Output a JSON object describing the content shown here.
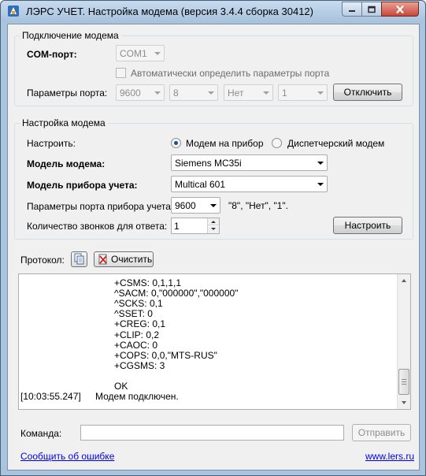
{
  "window": {
    "title": "ЛЭРС УЧЕТ. Настройка модема (версия 3.4.4 сборка 30412)"
  },
  "connection": {
    "group_title": "Подключение модема",
    "com_port_label": "COM-порт:",
    "com_port_value": "COM1",
    "auto_detect_label": "Автоматически определить параметры порта",
    "auto_detect_checked": false,
    "port_params_label": "Параметры порта:",
    "baud": "9600",
    "data_bits": "8",
    "parity": "Нет",
    "stop_bits": "1",
    "disconnect_button": "Отключить"
  },
  "modem_setup": {
    "group_title": "Настройка модема",
    "configure_label": "Настроить:",
    "radio_device": "Модем на прибор",
    "radio_dispatcher": "Диспетчерский модем",
    "selected_mode": "device",
    "modem_model_label": "Модель модема:",
    "modem_model_value": "Siemens MC35i",
    "meter_model_label": "Модель прибора учета:",
    "meter_model_value": "Multical 601",
    "meter_port_label": "Параметры порта прибора учета:",
    "meter_port_value": "9600",
    "meter_port_hint": "\"8\", \"Нет\", \"1\".",
    "rings_label": "Количество звонков для ответа:",
    "rings_value": "1",
    "configure_button": "Настроить"
  },
  "protocol": {
    "label": "Протокол:",
    "clear_button": "Очистить",
    "lines": [
      {
        "ts": "",
        "text": "+CSMS: 0,1,1,1"
      },
      {
        "ts": "",
        "text": "^SACM: 0,\"000000\",\"000000\""
      },
      {
        "ts": "",
        "text": "^SCKS: 0,1"
      },
      {
        "ts": "",
        "text": "^SSET: 0"
      },
      {
        "ts": "",
        "text": "+CREG: 0,1"
      },
      {
        "ts": "",
        "text": "+CLIP: 0,2"
      },
      {
        "ts": "",
        "text": "+CAOC: 0"
      },
      {
        "ts": "",
        "text": "+COPS: 0,0,\"MTS-RUS\""
      },
      {
        "ts": "",
        "text": "+CGSMS: 3"
      },
      {
        "ts": "",
        "text": ""
      },
      {
        "ts": "",
        "text": "OK"
      },
      {
        "ts": "[10:03:55.247]",
        "text": "Модем подключен."
      }
    ]
  },
  "command": {
    "label": "Команда:",
    "value": "",
    "send_button": "Отправить"
  },
  "footer": {
    "report_link": "Сообщить об ошибке",
    "site_link": "www.lers.ru"
  }
}
